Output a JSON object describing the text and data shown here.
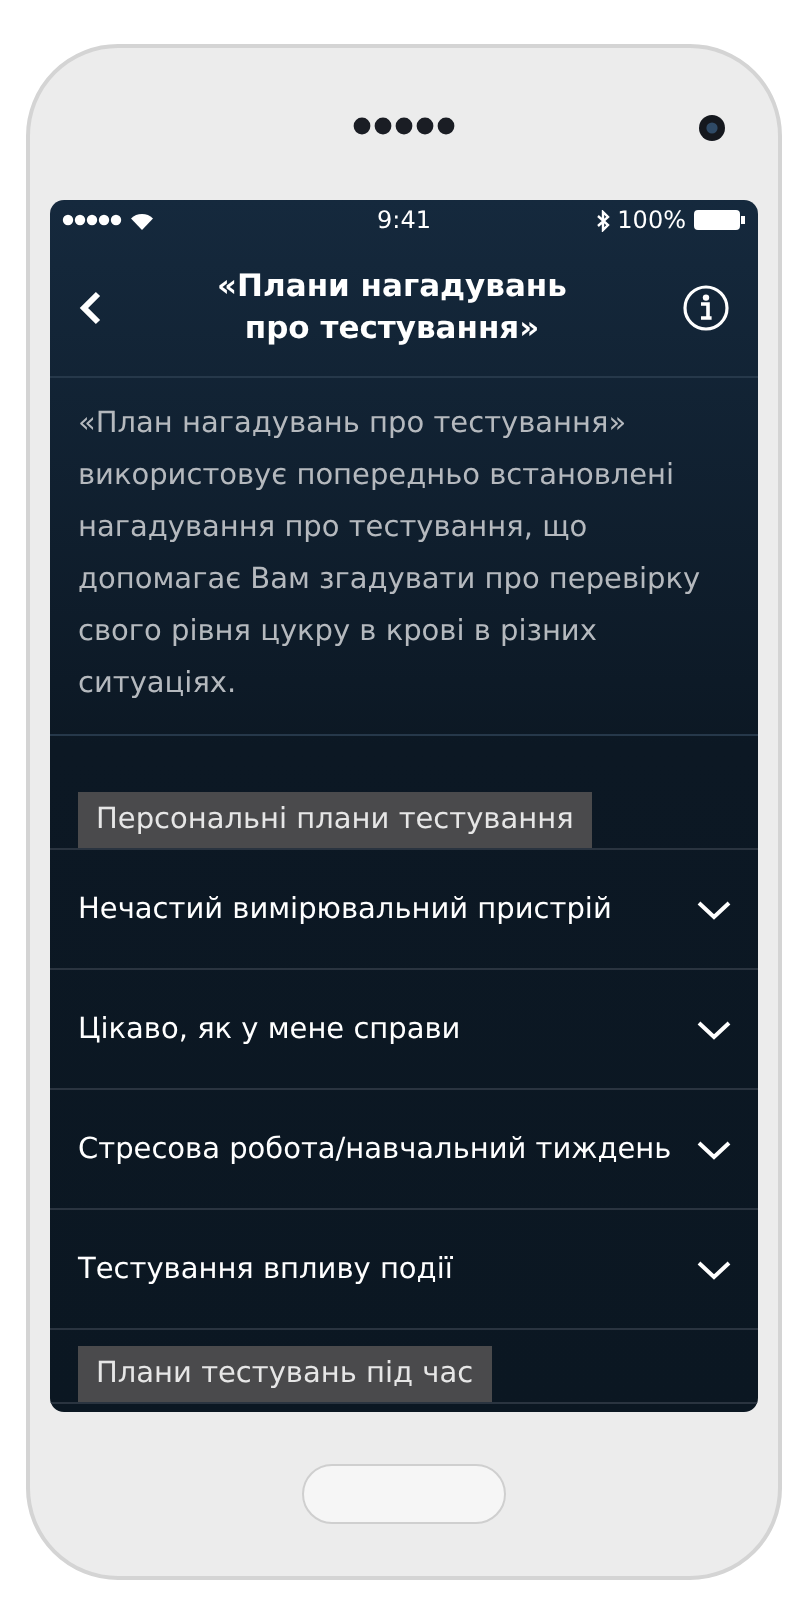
{
  "status_bar": {
    "time": "9:41",
    "battery": "100%"
  },
  "header": {
    "title": "«Плани нагадувань про тестування»"
  },
  "description": "«План нагадувань про тестування» використовує попередньо встановлені нагадування про тестування, що допомагає Вам згадувати про перевірку свого рівня цукру в крові в різних ситуаціях.",
  "sections": [
    {
      "heading": "Персональні плани тестування",
      "items": [
        {
          "label": "Нечастий вимірювальний пристрій",
          "expanded": false
        },
        {
          "label": "Цікаво, як у мене справи",
          "expanded": false
        },
        {
          "label": "Стресова робота/навчальний тиждень",
          "expanded": false
        },
        {
          "label": "Тестування впливу події",
          "expanded": false
        }
      ]
    },
    {
      "heading": "Плани тестувань під час"
    }
  ]
}
